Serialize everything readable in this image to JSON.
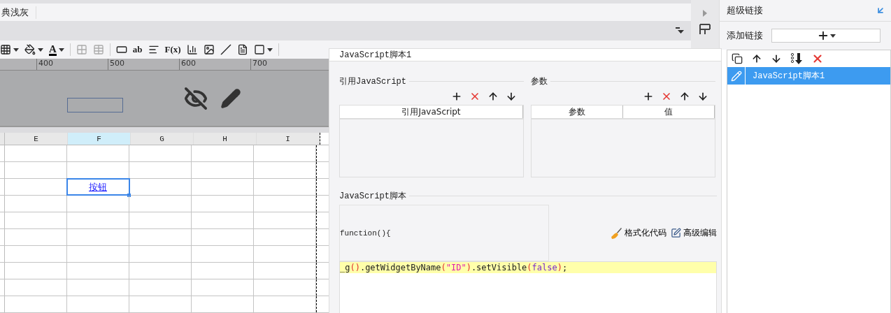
{
  "theme_tab": {
    "label": "典浅灰"
  },
  "toolbar": [
    {
      "kind": "icon",
      "caret": true,
      "disabled": false
    },
    {
      "kind": "icon",
      "caret": true,
      "disabled": false
    },
    {
      "kind": "text",
      "label": "A",
      "caret": true,
      "disabled": false
    },
    {
      "kind": "separator"
    },
    {
      "kind": "icon",
      "caret": false,
      "disabled": true
    },
    {
      "kind": "icon",
      "caret": false,
      "disabled": true
    },
    {
      "kind": "separator"
    },
    {
      "kind": "icon",
      "caret": false,
      "disabled": false
    },
    {
      "kind": "text",
      "label": "ab",
      "caret": false,
      "disabled": false
    },
    {
      "kind": "icon",
      "caret": false,
      "disabled": false
    },
    {
      "kind": "text",
      "label": "F(x)",
      "caret": false,
      "disabled": false
    },
    {
      "kind": "icon",
      "caret": false,
      "disabled": false
    },
    {
      "kind": "icon",
      "caret": false,
      "disabled": false
    },
    {
      "kind": "icon",
      "caret": false,
      "disabled": false
    },
    {
      "kind": "icon",
      "caret": false,
      "disabled": false
    },
    {
      "kind": "icon",
      "caret": true,
      "disabled": false
    },
    {
      "kind": "separator"
    }
  ],
  "ruler": {
    "labels": [
      "400",
      "500",
      "600",
      "700"
    ]
  },
  "sheet": {
    "columns": [
      {
        "label": "E",
        "selected": false
      },
      {
        "label": "F",
        "selected": true
      },
      {
        "label": "G",
        "selected": false
      },
      {
        "label": "H",
        "selected": false
      },
      {
        "label": "I",
        "selected": false
      }
    ],
    "rows": [
      {
        "selected": false
      },
      {
        "selected": false
      },
      {
        "selected": true,
        "link": "按钮"
      },
      {
        "selected": false
      },
      {
        "selected": false
      },
      {
        "selected": false
      },
      {
        "selected": false
      },
      {
        "selected": false
      },
      {
        "selected": false
      },
      {
        "selected": false
      }
    ]
  },
  "dialog": {
    "title": "JavaScript脚本1",
    "imports": {
      "legend": "引用JavaScript",
      "columns": [
        "引用JavaScript"
      ]
    },
    "params": {
      "legend": "参数",
      "columns": [
        "参数",
        "值"
      ]
    },
    "script": {
      "legend": "JavaScript脚本",
      "signature": "function(){",
      "buttons": [
        {
          "kind": "format",
          "label": "格式化代码"
        },
        {
          "kind": "edit",
          "label": "高级编辑"
        }
      ],
      "lines": [
        {
          "current": true,
          "tokens": [
            {
              "kind": "plain",
              "text": "_g"
            },
            {
              "kind": "paren",
              "text": "()"
            },
            {
              "kind": "plain",
              "text": ".getWidgetByName"
            },
            {
              "kind": "paren",
              "text": "("
            },
            {
              "kind": "string",
              "text": "\"ID\""
            },
            {
              "kind": "paren",
              "text": ")"
            },
            {
              "kind": "plain",
              "text": ".setVisible"
            },
            {
              "kind": "paren",
              "text": "("
            },
            {
              "kind": "keyword",
              "text": "false"
            },
            {
              "kind": "paren",
              "text": ")"
            },
            {
              "kind": "plain",
              "text": ";"
            }
          ]
        }
      ]
    }
  },
  "hyperlink_panel": {
    "title": "超级链接",
    "add_label": "添加链接",
    "links": [
      {
        "label": "JavaScript脚本1",
        "selected": true
      }
    ]
  }
}
